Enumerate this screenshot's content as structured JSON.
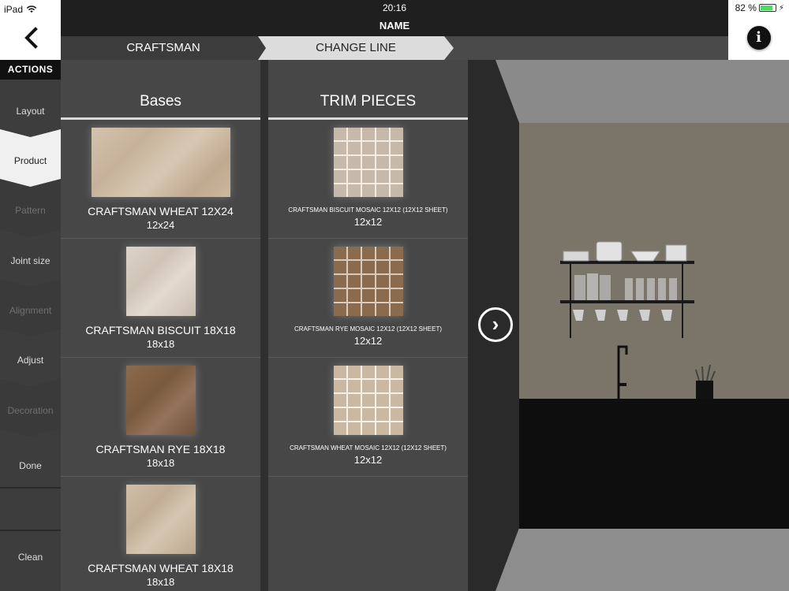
{
  "status": {
    "device": "iPad",
    "time": "20:16",
    "battery": "82 %",
    "battery_level": 0.82
  },
  "header": {
    "title": "NAME",
    "back_icon": "chevron-left-icon",
    "info_icon": "info-icon",
    "info_glyph": "i"
  },
  "breadcrumb": {
    "current": "CRAFTSMAN",
    "next": "CHANGE LINE"
  },
  "sidebar": {
    "heading": "ACTIONS",
    "items": [
      {
        "label": "Layout"
      },
      {
        "label": "Product"
      },
      {
        "label": "Pattern"
      },
      {
        "label": "Joint size"
      },
      {
        "label": "Alignment"
      },
      {
        "label": "Adjust"
      },
      {
        "label": "Decoration"
      },
      {
        "label": "Done"
      }
    ],
    "clean": "Clean"
  },
  "bases": {
    "heading": "Bases",
    "items": [
      {
        "name": "CRAFTSMAN WHEAT 12X24",
        "size": "12x24"
      },
      {
        "name": "CRAFTSMAN BISCUIT 18X18",
        "size": "18x18"
      },
      {
        "name": "CRAFTSMAN RYE 18X18",
        "size": "18x18"
      },
      {
        "name": "CRAFTSMAN WHEAT 18X18",
        "size": "18x18"
      }
    ]
  },
  "trim": {
    "heading": "TRIM PIECES",
    "items": [
      {
        "name": "CRAFTSMAN BISCUIT MOSAIC 12X12 (12X12 SHEET)",
        "size": "12x12"
      },
      {
        "name": "CRAFTSMAN RYE MOSAIC 12X12 (12X12 SHEET)",
        "size": "12x12"
      },
      {
        "name": "CRAFTSMAN WHEAT MOSAIC 12X12 (12X12 SHEET)",
        "size": "12x12"
      }
    ]
  },
  "next_glyph": "›",
  "colors": {
    "panel": "#474747",
    "sidebar": "#3d3d3d",
    "active": "#f0f0f0",
    "accent_battery": "#4cd964"
  }
}
